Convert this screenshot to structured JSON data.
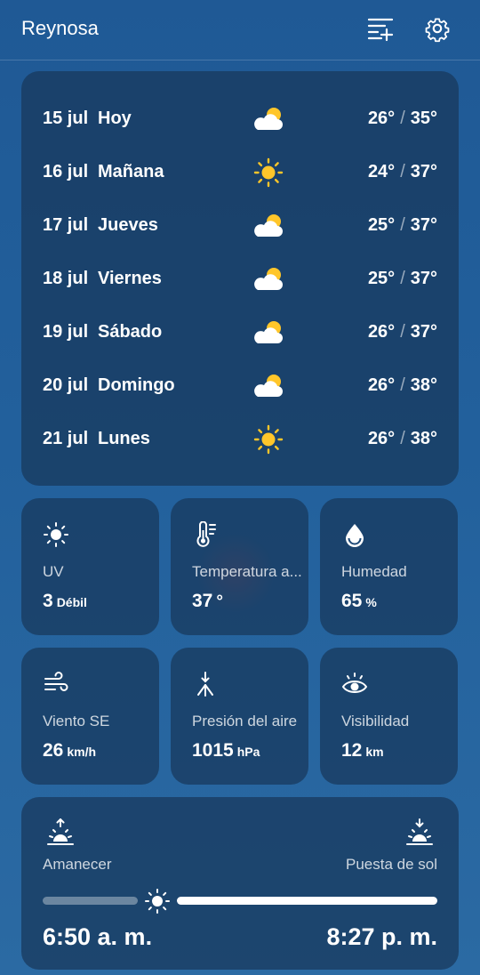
{
  "header": {
    "city": "Reynosa",
    "icons": [
      "add-list-icon",
      "gear-icon"
    ]
  },
  "forecast": [
    {
      "date": "15 jul",
      "day": "Hoy",
      "icon": "partly-cloudy-icon",
      "low": "26°",
      "high": "35°"
    },
    {
      "date": "16 jul",
      "day": "Mañana",
      "icon": "sun-icon",
      "low": "24°",
      "high": "37°"
    },
    {
      "date": "17 jul",
      "day": "Jueves",
      "icon": "partly-cloudy-icon",
      "low": "25°",
      "high": "37°"
    },
    {
      "date": "18 jul",
      "day": "Viernes",
      "icon": "partly-cloudy-icon",
      "low": "25°",
      "high": "37°"
    },
    {
      "date": "19 jul",
      "day": "Sábado",
      "icon": "partly-cloudy-icon",
      "low": "26°",
      "high": "37°"
    },
    {
      "date": "20 jul",
      "day": "Domingo",
      "icon": "partly-cloudy-icon",
      "low": "26°",
      "high": "38°"
    },
    {
      "date": "21 jul",
      "day": "Lunes",
      "icon": "sun-icon",
      "low": "26°",
      "high": "38°"
    }
  ],
  "separator": "/",
  "details": {
    "uv": {
      "label": "UV",
      "value": "3",
      "unit": "Débil",
      "icon": "sun-icon"
    },
    "feels": {
      "label": "Temperatura a...",
      "value": "37",
      "unit": "°",
      "icon": "thermometer-icon"
    },
    "humidity": {
      "label": "Humedad",
      "value": "65",
      "unit": "%",
      "icon": "droplet-icon"
    },
    "wind": {
      "label": "Viento SE",
      "value": "26",
      "unit": "km/h",
      "icon": "wind-icon"
    },
    "pressure": {
      "label": "Presión del aire",
      "value": "1015",
      "unit": "hPa",
      "icon": "pressure-icon"
    },
    "visibility": {
      "label": "Visibilidad",
      "value": "12",
      "unit": "km",
      "icon": "eye-icon"
    }
  },
  "sun": {
    "sunrise_label": "Amanecer",
    "sunset_label": "Puesta de sol",
    "sunrise_time": "6:50 a. m.",
    "sunset_time": "8:27 p. m.",
    "day_progress": 0.29
  },
  "colors": {
    "sun": "#ffc62a",
    "cloud": "#ffffff"
  }
}
